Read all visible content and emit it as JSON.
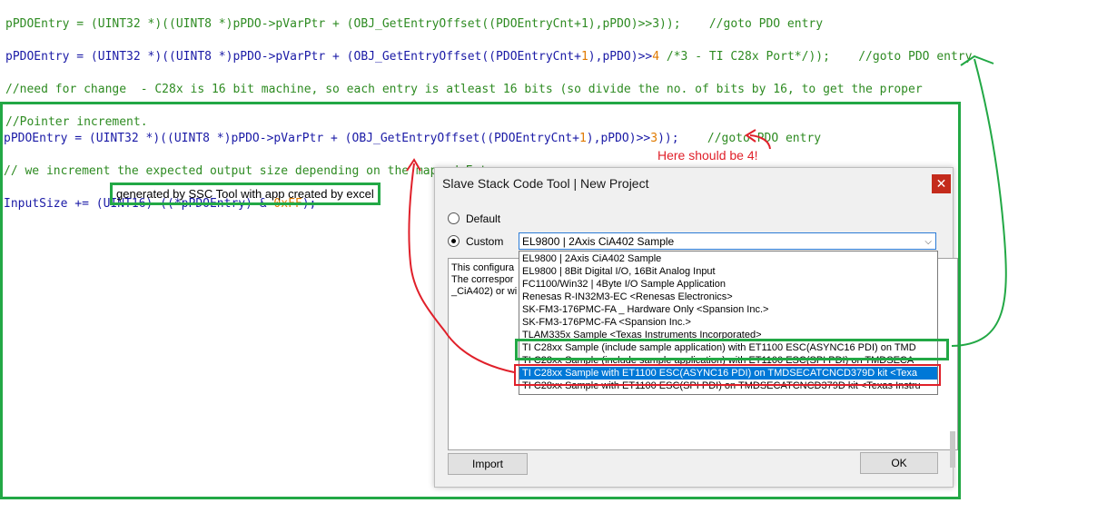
{
  "top_code": {
    "line1": [
      {
        "t": "pPDOEntry = (UINT32 *)((UINT8 *)pPDO->pVarPtr + (OBJ_GetEntryOffset((PDOEntryCnt+1),pPDO)>>3));    ",
        "c": "g"
      },
      {
        "t": "//goto PDO entry",
        "c": "g"
      }
    ],
    "line2": [
      {
        "t": "pPDOEntry = ",
        "c": "b"
      },
      {
        "t": "(UINT32 *)((UINT8 *)pPDO->pVarPtr + (OBJ_GetEntryOffset((PDOEntryCnt+",
        "c": "b"
      },
      {
        "t": "1",
        "c": "o"
      },
      {
        "t": "),pPDO)>>",
        "c": "b"
      },
      {
        "t": "4",
        "c": "o"
      },
      {
        "t": " /*3 - TI C28x Port*/));    //goto PDO entry",
        "c": "g"
      }
    ],
    "line3": "//need for change  - C28x is 16 bit machine, so each entry is atleast 16 bits (so divide the no. of bits by 16, to get the proper",
    "line4": "//Pointer increment."
  },
  "frame_code": {
    "line1a": "pPDOEntry = (UINT32 *)((UINT8 *)pPDO->pVarPtr + (OBJ_GetEntryOffset((PDOEntryCnt+",
    "line1b": "1",
    "line1c": "),pPDO)>>",
    "line1d": "3",
    "line1e": "));    ",
    "line1f": "//goto PDO entry",
    "line2": "// we increment the expected output size depending on the mapped Entry",
    "line3a": "InputSize += (UINT16) ((*pPDOEntry) & ",
    "line3b": "0xFF",
    "line3c": ");"
  },
  "annotations": {
    "ssc_note": "generated by SSC Tool with app created by excel",
    "here_should_be": "Here should be 4!"
  },
  "dialog": {
    "title": "Slave Stack Code Tool | New Project",
    "close_glyph": "✕",
    "radio_default": "Default",
    "radio_custom": "Custom",
    "combo_value": "EL9800 | 2Axis CiA402 Sample",
    "combo_arrow": "⌵",
    "desc_lines": [
      "This configura",
      "The correspor",
      "_CiA402) or wi"
    ],
    "dropdown_items": [
      "EL9800 | 2Axis CiA402 Sample",
      "EL9800 | 8Bit Digital I/O, 16Bit Analog Input",
      "FC1100/Win32 | 4Byte I/O Sample Application",
      "Renesas R-IN32M3-EC <Renesas Electronics>",
      "SK-FM3-176PMC-FA _ Hardware Only <Spansion Inc.>",
      "SK-FM3-176PMC-FA <Spansion Inc.>",
      "TLAM335x Sample <Texas Instruments Incorporated>",
      "TI C28xx Sample (include sample application) with ET1100 ESC(ASYNC16 PDI) on TMD",
      "TI C28xx Sample (include sample application) with ET1100 ESC(SPI PDI) on TMDSECA",
      "TI C28xx Sample with ET1100 ESC(ASYNC16 PDI) on TMDSECATCNCD379D kit <Texa",
      "TI C28xx Sample with ET1100 ESC(SPI PDI) on TMDSECATCNCD379D kit <Texas Instru"
    ],
    "selected_index": 9,
    "import_label": "Import",
    "ok_label": "OK"
  },
  "colors": {
    "highlight_green": "#22a845",
    "highlight_red": "#e0202a",
    "selection_blue": "#0078d7"
  }
}
